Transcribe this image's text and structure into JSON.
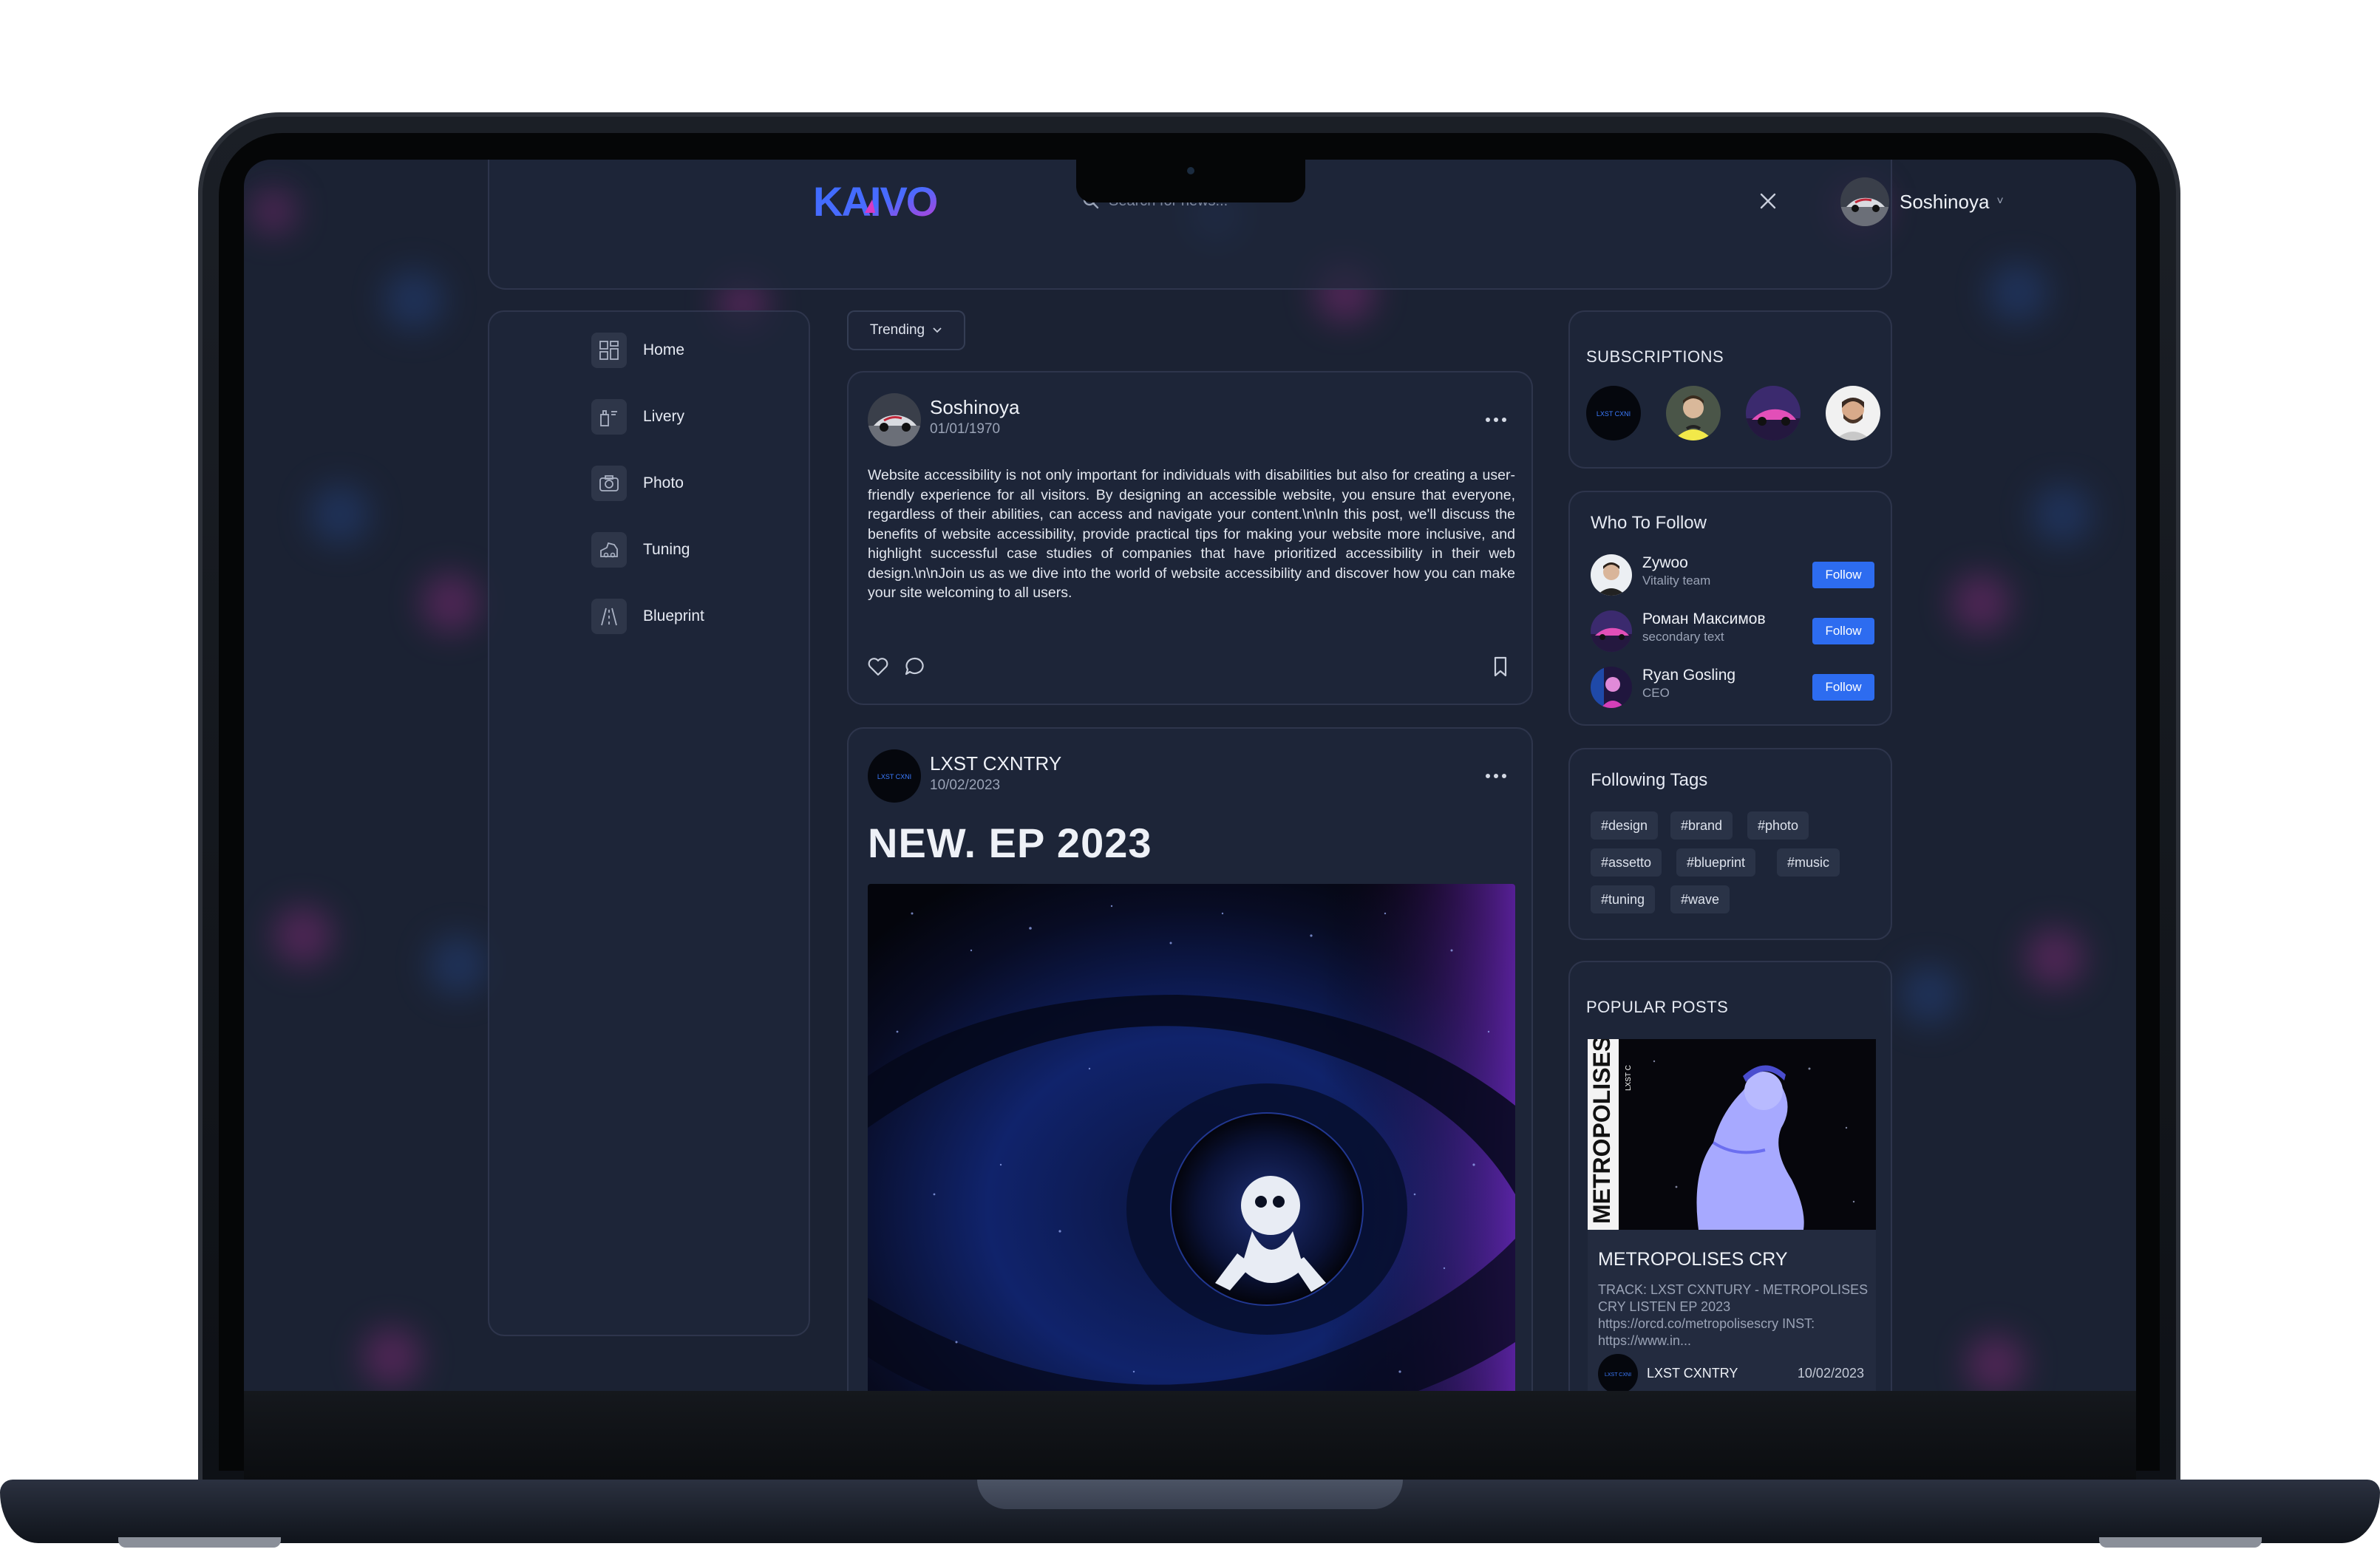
{
  "app": {
    "logo_text": "KAIVO"
  },
  "header": {
    "search_placeholder": "Search for news...",
    "user_name": "Soshinoya",
    "user_chevron": "˅"
  },
  "sidebar": {
    "items": [
      {
        "label": "Home",
        "icon": "grid-icon"
      },
      {
        "label": "Livery",
        "icon": "livery-icon"
      },
      {
        "label": "Photo",
        "icon": "camera-icon"
      },
      {
        "label": "Tuning",
        "icon": "tuning-icon"
      },
      {
        "label": "Blueprint",
        "icon": "road-icon"
      }
    ]
  },
  "feed": {
    "filter_label": "Trending",
    "posts": [
      {
        "author": "Soshinoya",
        "date": "01/01/1970",
        "text": "Website accessibility is not only important for individuals with disabilities but also for creating a user-friendly experience for all visitors. By designing an accessible website, you ensure that everyone, regardless of their abilities, can access and navigate your content.\\n\\nIn this post, we'll discuss the benefits of website accessibility, provide practical tips for making your website more inclusive, and highlight successful case studies of companies that have prioritized accessibility in their web design.\\n\\nJoin us as we dive into the world of website accessibility and discover how you can make your site welcoming to all users."
      },
      {
        "author": "LXST CXNTRY",
        "date": "10/02/2023",
        "title": "NEW. EP 2023"
      }
    ]
  },
  "subscriptions": {
    "title": "SUBSCRIPTIONS"
  },
  "who_to_follow": {
    "title": "Who To Follow",
    "button_label": "Follow",
    "users": [
      {
        "name": "Zywoo",
        "subtitle": "Vitality team"
      },
      {
        "name": "Роман Максимов",
        "subtitle": "secondary text"
      },
      {
        "name": "Ryan Gosling",
        "subtitle": "CEO"
      }
    ]
  },
  "following_tags": {
    "title": "Following Tags",
    "tags": [
      "#design",
      "#brand",
      "#photo",
      "#assetto",
      "#blueprint",
      "#music",
      "#tuning",
      "#wave"
    ]
  },
  "popular_posts": {
    "title": "POPULAR POSTS",
    "post": {
      "title": "METROPOLISES CRY",
      "description": "TRACK: LXST CXNTURY - METROPOLISES CRY LISTEN EP 2023 https://orcd.co/metropolisescry INST: https://www.in...",
      "author": "LXST CXNTRY",
      "date": "10/02/2023",
      "image_text": "METROPOLISES C",
      "image_subtext": "LXST C"
    }
  },
  "colors": {
    "accent": "#2d6cf0",
    "background": "#1b2233",
    "logo_blue": "#3b6cff",
    "logo_pink": "#c23bd4"
  }
}
